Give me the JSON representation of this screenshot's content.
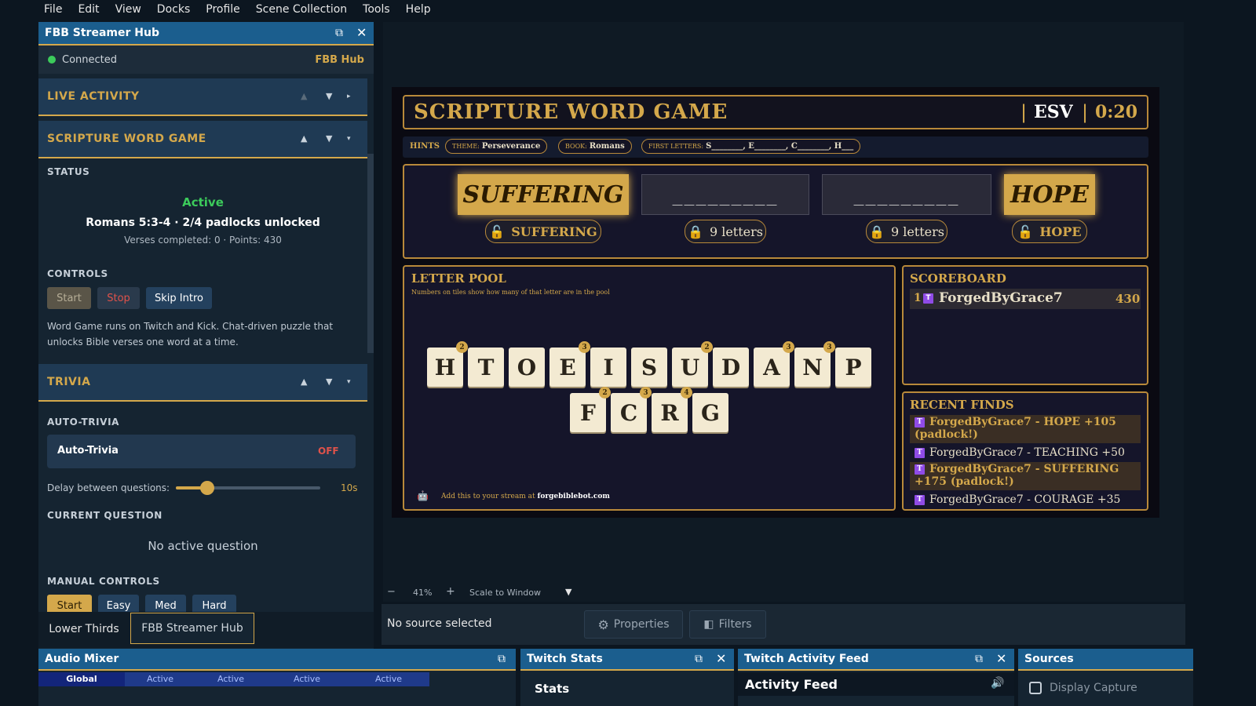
{
  "menu": [
    "File",
    "Edit",
    "View",
    "Docks",
    "Profile",
    "Scene Collection",
    "Tools",
    "Help"
  ],
  "hub": {
    "title": "FBB Streamer Hub",
    "status": "Connected",
    "brand": "FBB Hub",
    "sections": {
      "live": "LIVE ACTIVITY",
      "word": "SCRIPTURE WORD GAME",
      "trivia": "TRIVIA"
    },
    "status_label": "STATUS",
    "state": "Active",
    "verse_line": "Romans 5:3-4 · 2/4 padlocks unlocked",
    "stats_line": "Verses completed: 0 · Points: 430",
    "controls_label": "CONTROLS",
    "start": "Start",
    "stop": "Stop",
    "skip": "Skip Intro",
    "desc": "Word Game runs on Twitch and Kick. Chat-driven puzzle that unlocks Bible verses one word at a time.",
    "auto_trivia_label": "AUTO-TRIVIA",
    "auto_trivia": "Auto-Trivia",
    "auto_state": "OFF",
    "delay_label": "Delay between questions:",
    "delay_value": "10s",
    "delay_fraction": 0.22,
    "current_q_label": "CURRENT QUESTION",
    "no_question": "No active question",
    "manual_label": "MANUAL CONTROLS",
    "manual": [
      "Start",
      "Easy",
      "Med",
      "Hard"
    ]
  },
  "tabs": {
    "lower_thirds": "Lower Thirds",
    "hub": "FBB Streamer Hub"
  },
  "game": {
    "title": "SCRIPTURE WORD GAME",
    "version": "ESV",
    "timer": "0:20",
    "hints_label": "HINTS",
    "theme_label": "THEME:",
    "theme": "Perseverance",
    "book_label": "BOOK:",
    "book": "Romans",
    "first_label": "FIRST LETTERS:",
    "first": "S________, E________, C________, H___",
    "words": [
      {
        "shown": "SUFFERING",
        "lock": "SUFFERING",
        "solved": true
      },
      {
        "shown": "_________",
        "lock": "9 letters",
        "solved": false
      },
      {
        "shown": "_________",
        "lock": "9 letters",
        "solved": false
      },
      {
        "shown": "HOPE",
        "lock": "HOPE",
        "solved": true
      }
    ],
    "pool_title": "LETTER POOL",
    "pool_sub": "Numbers on tiles show how many of that letter are in the pool",
    "row1": [
      {
        "l": "H",
        "n": "2"
      },
      {
        "l": "T",
        "n": ""
      },
      {
        "l": "O",
        "n": ""
      },
      {
        "l": "E",
        "n": "3"
      },
      {
        "l": "I",
        "n": ""
      },
      {
        "l": "S",
        "n": ""
      },
      {
        "l": "U",
        "n": "2"
      },
      {
        "l": "D",
        "n": ""
      },
      {
        "l": "A",
        "n": "3"
      },
      {
        "l": "N",
        "n": "3"
      },
      {
        "l": "P",
        "n": ""
      }
    ],
    "row2": [
      {
        "l": "F",
        "n": "2"
      },
      {
        "l": "C",
        "n": "3"
      },
      {
        "l": "R",
        "n": "4"
      },
      {
        "l": "G",
        "n": ""
      }
    ],
    "footer_pre": "Add this to your stream at",
    "footer_url": "forgebiblebot.com",
    "scoreboard_title": "SCOREBOARD",
    "score": {
      "rank": "1",
      "platform": "T",
      "name": "ForgedByGrace7",
      "points": "430"
    },
    "recent_title": "RECENT FINDS",
    "recent": [
      {
        "platform": "T",
        "text": "ForgedByGrace7 - HOPE +105 (padlock!)",
        "highlight": true
      },
      {
        "platform": "T",
        "text": "ForgedByGrace7 - TEACHING +50",
        "highlight": false
      },
      {
        "platform": "T",
        "text": "ForgedByGrace7 - SUFFERING +175 (padlock!)",
        "highlight": true
      },
      {
        "platform": "T",
        "text": "ForgedByGrace7 - COURAGE +35",
        "highlight": false
      }
    ]
  },
  "zoom": {
    "minus": "−",
    "value": "41%",
    "plus": "+",
    "scale": "Scale to Window"
  },
  "source": {
    "none": "No source selected",
    "properties": "Properties",
    "filters": "Filters"
  },
  "audio": {
    "title": "Audio Mixer",
    "cols": [
      "Global",
      "Active",
      "Active",
      "Active",
      "Active"
    ]
  },
  "twitch_stats": {
    "title": "Twitch Stats",
    "sub": "Stats"
  },
  "activity": {
    "title": "Twitch Activity Feed",
    "sub": "Activity Feed"
  },
  "sources": {
    "title": "Sources",
    "item": "Display Capture"
  },
  "colors": {
    "accent_gold": "#d4a84b",
    "dock_blue": "#1b5e8e",
    "active_green": "#3ccb5b",
    "off_red": "#e0524a"
  }
}
